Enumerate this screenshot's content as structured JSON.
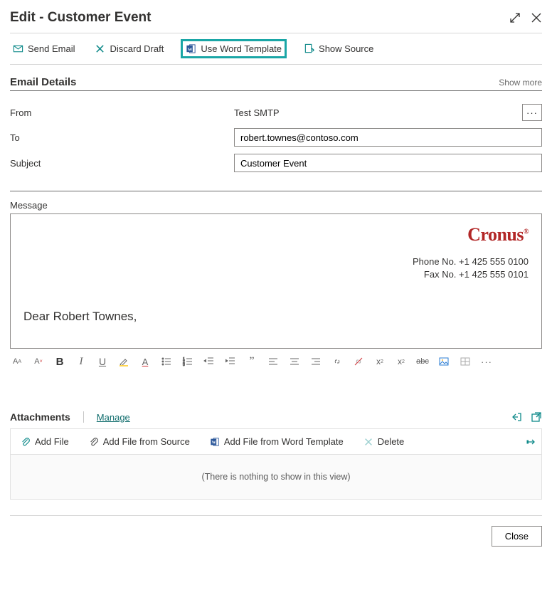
{
  "header": {
    "title": "Edit - Customer Event"
  },
  "toolbar": {
    "send_email": "Send Email",
    "discard_draft": "Discard Draft",
    "use_word_template": "Use Word Template",
    "show_source": "Show Source"
  },
  "section": {
    "title": "Email Details",
    "show_more": "Show more"
  },
  "form": {
    "from_label": "From",
    "from_value": "Test SMTP",
    "to_label": "To",
    "to_value": "robert.townes@contoso.com",
    "subject_label": "Subject",
    "subject_value": "Customer Event",
    "ellipsis": "···"
  },
  "message": {
    "label": "Message",
    "logo_text": "Cronus",
    "logo_mark": "®",
    "phone": "Phone No. +1 425 555 0100",
    "fax": "Fax No. +1 425 555 0101",
    "greeting": "Dear Robert Townes,"
  },
  "attachments": {
    "title": "Attachments",
    "manage": "Manage",
    "add_file": "Add File",
    "add_file_source": "Add File from Source",
    "add_file_word": "Add File from Word Template",
    "delete": "Delete",
    "empty": "(There is nothing to show in this view)"
  },
  "footer": {
    "close": "Close"
  },
  "colors": {
    "teal_highlight": "#1aa6a6",
    "accent_teal": "#0f6c6c",
    "logo_red": "#b22727"
  }
}
